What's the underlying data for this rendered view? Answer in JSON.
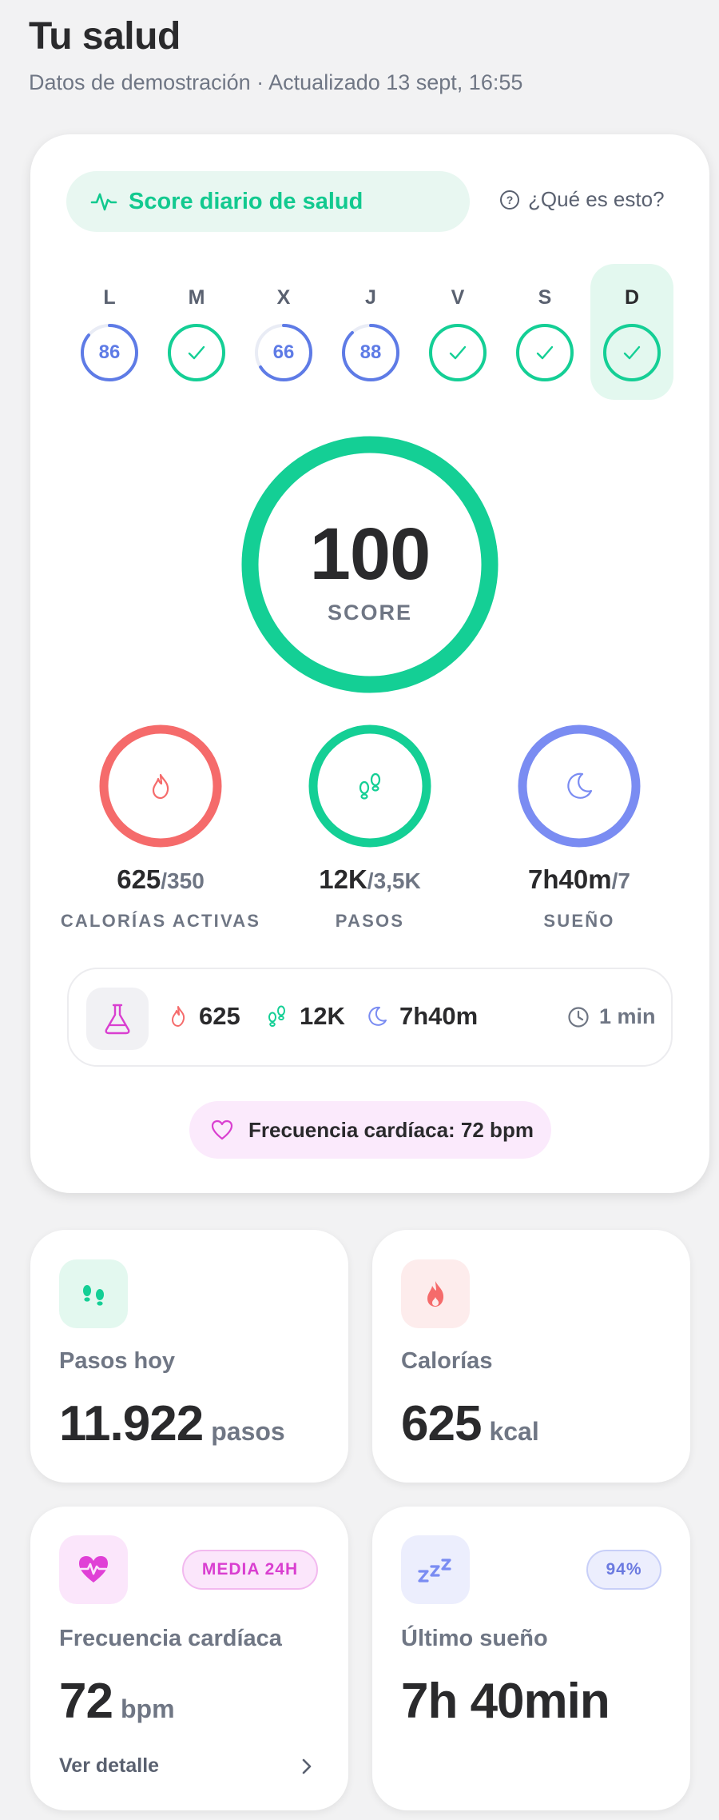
{
  "header": {
    "title": "Tu salud",
    "subtitle": "Datos de demostración · Actualizado 13 sept, 16:55"
  },
  "score_card": {
    "pill_label": "Score diario de salud",
    "help_label": "¿Qué es esto?",
    "week": [
      {
        "day": "L",
        "value": "86",
        "status": "score",
        "progress": 0.86
      },
      {
        "day": "M",
        "value": "",
        "status": "done",
        "progress": 1.0
      },
      {
        "day": "X",
        "value": "66",
        "status": "score",
        "progress": 0.66
      },
      {
        "day": "J",
        "value": "88",
        "status": "score",
        "progress": 0.88
      },
      {
        "day": "V",
        "value": "",
        "status": "done",
        "progress": 1.0
      },
      {
        "day": "S",
        "value": "",
        "status": "done",
        "progress": 1.0
      },
      {
        "day": "D",
        "value": "",
        "status": "done",
        "progress": 1.0,
        "active": true
      }
    ],
    "score_value": "100",
    "score_label": "SCORE",
    "score_progress": 1.0,
    "metrics": {
      "calories": {
        "value": "625",
        "goal": "/350",
        "caption": "CALORÍAS ACTIVAS",
        "icon": "flame-icon",
        "color": "#f56b6b",
        "progress": 1.0
      },
      "steps": {
        "value": "12K",
        "goal": "/3,5K",
        "caption": "PASOS",
        "icon": "footprints-icon",
        "color": "#14cf95",
        "progress": 1.0
      },
      "sleep": {
        "value": "7h40m",
        "goal": "/7",
        "caption": "SUEÑO",
        "icon": "moon-icon",
        "color": "#7a8cf2",
        "progress": 1.0
      }
    },
    "summary": {
      "calories": "625",
      "steps": "12K",
      "sleep": "7h40m",
      "time": "1 min"
    },
    "heart_rate_pill": "Frecuencia cardíaca: 72 bpm"
  },
  "cards": {
    "steps": {
      "title": "Pasos hoy",
      "value": "11.922",
      "unit": "pasos"
    },
    "calories": {
      "title": "Calorías",
      "value": "625",
      "unit": "kcal"
    },
    "heart": {
      "title": "Frecuencia cardíaca",
      "value": "72",
      "unit": "bpm",
      "badge": "MEDIA 24H",
      "link": "Ver detalle"
    },
    "sleep": {
      "title": "Último sueño",
      "value": "7h 40min",
      "badge": "94%"
    }
  },
  "colors": {
    "green": "#14cf95",
    "blue": "#5e7be6",
    "red": "#f56b6b",
    "pink": "#e040d6",
    "lavender": "#7a8cf2"
  }
}
